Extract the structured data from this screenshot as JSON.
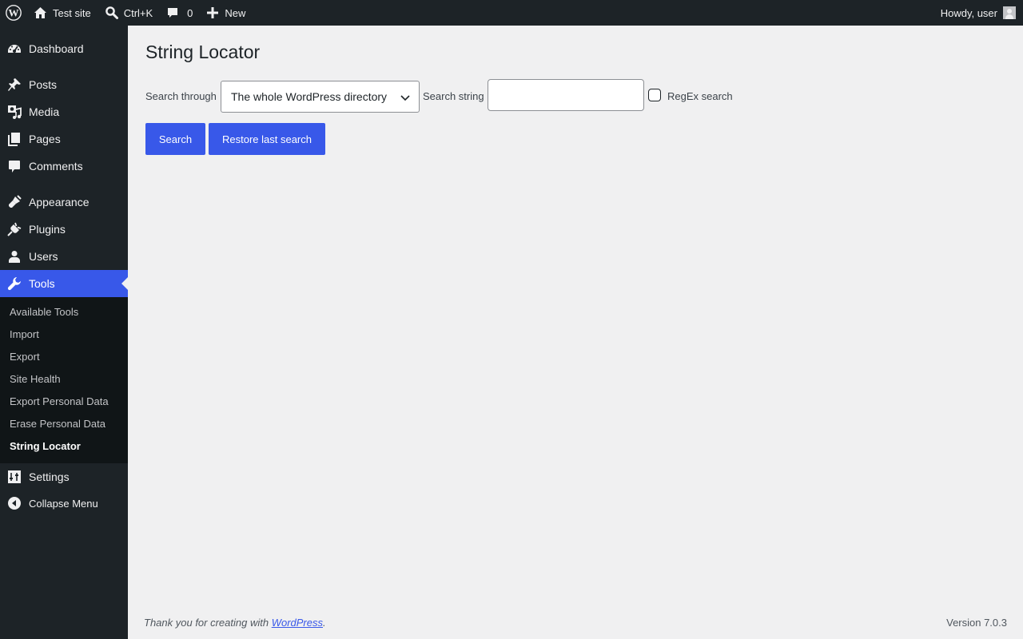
{
  "adminbar": {
    "site_name": "Test site",
    "search_shortcut": "Ctrl+K",
    "comments_count": "0",
    "new_label": "New",
    "greeting": "Howdy, user"
  },
  "sidebar": {
    "items": [
      {
        "label": "Dashboard",
        "icon": "dashboard-icon"
      },
      {
        "label": "Posts",
        "icon": "pushpin-icon"
      },
      {
        "label": "Media",
        "icon": "media-icon"
      },
      {
        "label": "Pages",
        "icon": "pages-icon"
      },
      {
        "label": "Comments",
        "icon": "comment-icon"
      },
      {
        "label": "Appearance",
        "icon": "brush-icon"
      },
      {
        "label": "Plugins",
        "icon": "plug-icon"
      },
      {
        "label": "Users",
        "icon": "user-icon"
      },
      {
        "label": "Tools",
        "icon": "wrench-icon"
      },
      {
        "label": "Settings",
        "icon": "sliders-icon"
      }
    ],
    "submenu": [
      "Available Tools",
      "Import",
      "Export",
      "Site Health",
      "Export Personal Data",
      "Erase Personal Data",
      "String Locator"
    ],
    "collapse_label": "Collapse Menu"
  },
  "colors": {
    "accent": "#3858e9",
    "sidebar_bg": "#1d2327",
    "page_bg": "#f0f0f1"
  },
  "main": {
    "title": "String Locator",
    "search_through_label": "Search through",
    "scope_value": "The whole WordPress directory",
    "search_string_label": "Search string",
    "search_string_value": "",
    "regex_label": "RegEx search",
    "search_button": "Search",
    "restore_button": "Restore last search"
  },
  "footer": {
    "thanks_prefix": "Thank you for creating with ",
    "thanks_link": "WordPress",
    "thanks_suffix": ".",
    "version": "Version 7.0.3"
  }
}
